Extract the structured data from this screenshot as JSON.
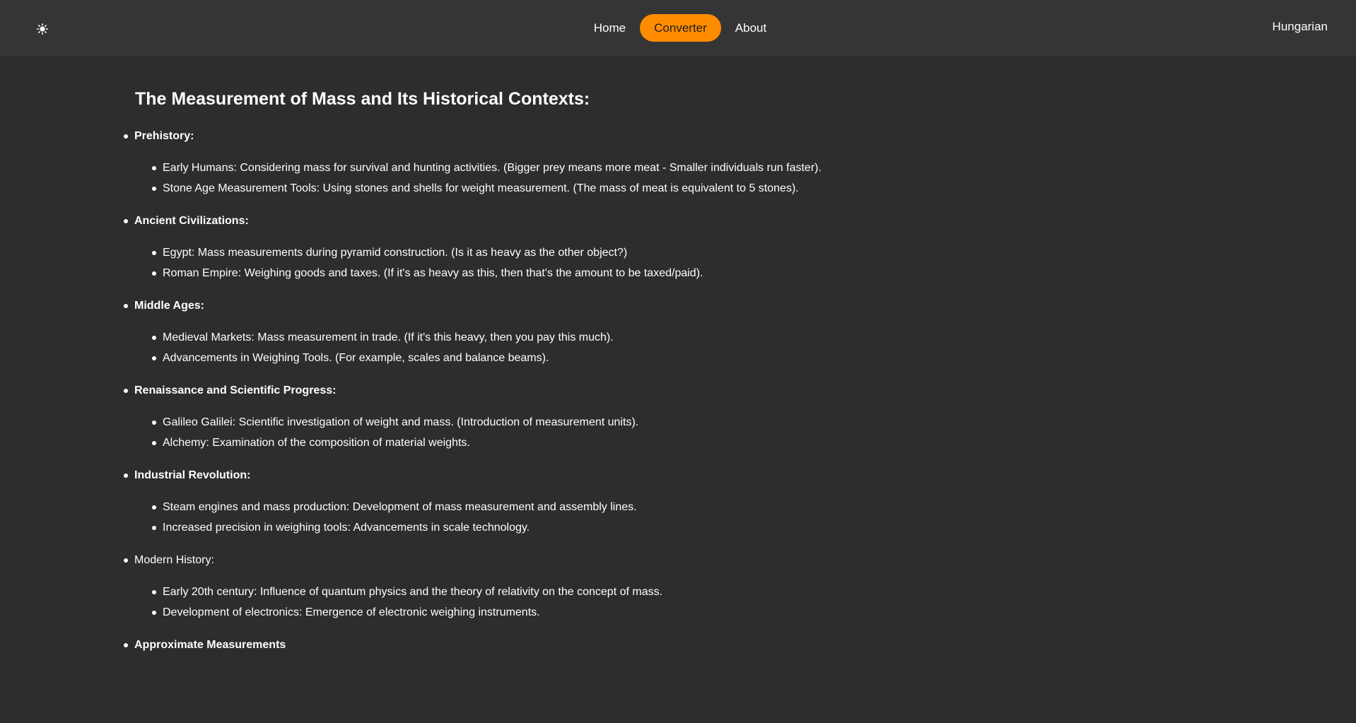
{
  "header": {
    "theme_icon": "sun-icon",
    "nav": [
      {
        "label": "Home",
        "active": false
      },
      {
        "label": "Converter",
        "active": true
      },
      {
        "label": "About",
        "active": false
      }
    ],
    "language": "Hungarian",
    "accent_color": "#ff8c00"
  },
  "main": {
    "title": "The Measurement of Mass and Its Historical Contexts:",
    "sections": [
      {
        "heading": "Prehistory:",
        "bold": true,
        "items": [
          "Early Humans: Considering mass for survival and hunting activities. (Bigger prey means more meat - Smaller individuals run faster).",
          "Stone Age Measurement Tools: Using stones and shells for weight measurement. (The mass of meat is equivalent to 5 stones)."
        ]
      },
      {
        "heading": "Ancient Civilizations:",
        "bold": true,
        "items": [
          "Egypt: Mass measurements during pyramid construction. (Is it as heavy as the other object?)",
          "Roman Empire: Weighing goods and taxes. (If it's as heavy as this, then that's the amount to be taxed/paid)."
        ]
      },
      {
        "heading": "Middle Ages:",
        "bold": true,
        "items": [
          "Medieval Markets: Mass measurement in trade. (If it's this heavy, then you pay this much).",
          "Advancements in Weighing Tools. (For example, scales and balance beams)."
        ]
      },
      {
        "heading": "Renaissance and Scientific Progress:",
        "bold": true,
        "items": [
          "Galileo Galilei: Scientific investigation of weight and mass. (Introduction of measurement units).",
          "Alchemy: Examination of the composition of material weights."
        ]
      },
      {
        "heading": "Industrial Revolution:",
        "bold": true,
        "items": [
          "Steam engines and mass production: Development of mass measurement and assembly lines.",
          "Increased precision in weighing tools: Advancements in scale technology."
        ]
      },
      {
        "heading": "Modern History:",
        "bold": false,
        "items": [
          "Early 20th century: Influence of quantum physics and the theory of relativity on the concept of mass.",
          "Development of electronics: Emergence of electronic weighing instruments."
        ]
      },
      {
        "heading": "Approximate Measurements",
        "bold": true,
        "items": []
      }
    ]
  }
}
